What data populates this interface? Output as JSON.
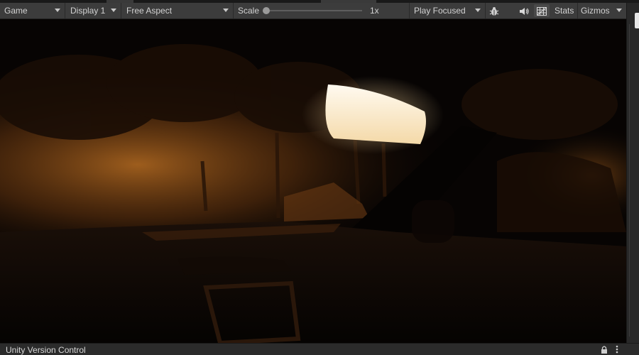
{
  "toolbar": {
    "view_mode": "Game",
    "display": "Display 1",
    "aspect": "Free Aspect",
    "scale_label": "Scale",
    "scale_value": "1x",
    "play_mode": "Play Focused",
    "stats_label": "Stats",
    "gizmos_label": "Gizmos"
  },
  "icons": {
    "bug": "bug-icon",
    "audio": "speaker-icon",
    "grid": "grid-icon",
    "lock": "lock-icon",
    "menu": "more-vertical-icon"
  },
  "bottom_panel": {
    "title": "Unity Version Control"
  },
  "colors": {
    "toolbar_bg": "#3c3c3c",
    "panel_bg": "#282828",
    "text": "#d2d2d2",
    "headlight": "#fff4e0"
  }
}
